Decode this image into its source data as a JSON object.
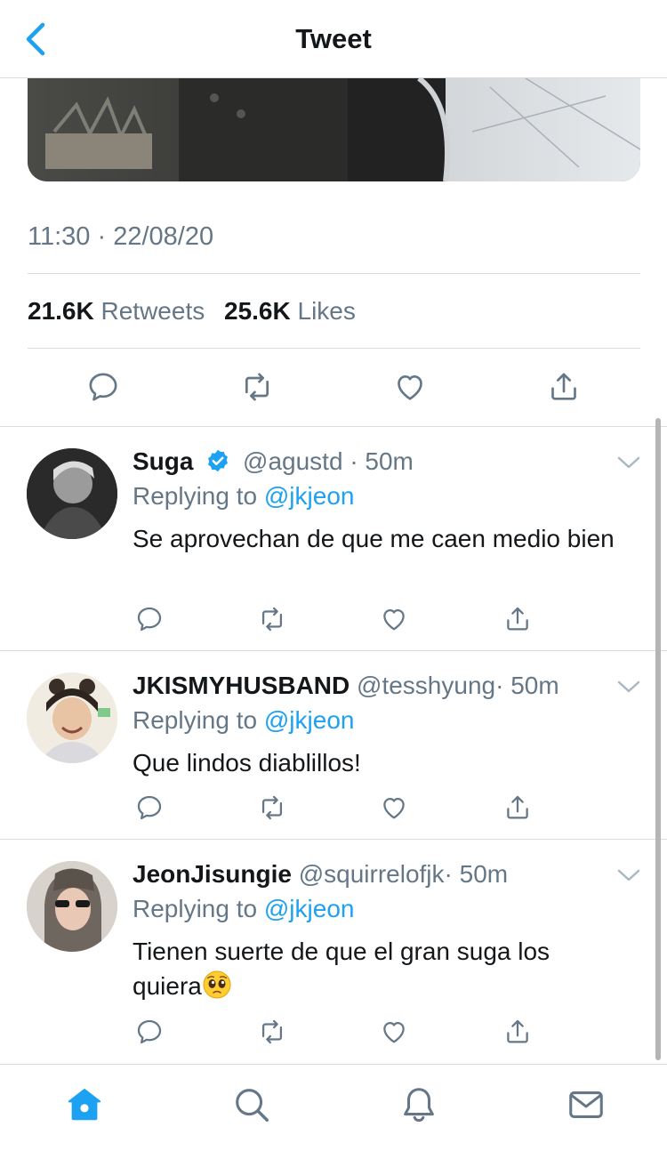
{
  "header": {
    "title": "Tweet"
  },
  "tweet": {
    "timestamp": "11:30 · 22/08/20",
    "retweets_count": "21.6K",
    "retweets_label": "Retweets",
    "likes_count": "25.6K",
    "likes_label": "Likes"
  },
  "replies": [
    {
      "name": "Suga",
      "handle": "@agustd",
      "time": "· 50m",
      "replying_prefix": "Replying to ",
      "replying_to": "@jkjeon",
      "text": "Se aprovechan de que me caen medio bien"
    },
    {
      "name": "JKISMYHUSBAND",
      "handle": "@tesshyung",
      "time": "· 50m",
      "replying_prefix": "Replying to ",
      "replying_to": "@jkjeon",
      "text": "Que lindos diablillos!"
    },
    {
      "name": "JeonJisungie",
      "handle": "@squirrelofjk",
      "time": "· 50m",
      "replying_prefix": "Replying to ",
      "replying_to": "@jkjeon",
      "text_line1": "Tienen suerte de que el gran suga los",
      "text_line2": "quiera"
    }
  ],
  "colors": {
    "accent": "#1da1f2",
    "secondary_text": "#657786",
    "divider": "#d9dde1"
  },
  "icons": [
    "back-chevron-icon",
    "reply-icon",
    "retweet-icon",
    "like-icon",
    "share-icon",
    "verified-badge-icon",
    "chevron-down-icon",
    "home-icon",
    "search-icon",
    "notifications-icon",
    "messages-icon",
    "pleading-face-emoji"
  ]
}
